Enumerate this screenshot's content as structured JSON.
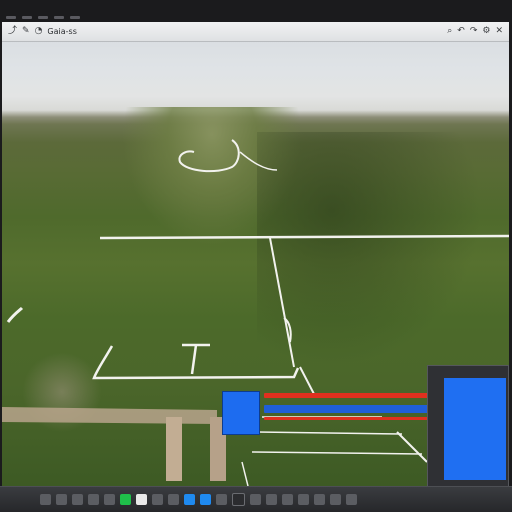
{
  "toolbar": {
    "left_icons": [
      "pointer-icon",
      "pen-icon",
      "shape-icon"
    ],
    "title": "Gaia-ss",
    "right_icons": [
      "search-icon",
      "undo-icon",
      "redo-icon",
      "settings-icon",
      "close-icon"
    ]
  },
  "glyphs": {
    "pointer": "⤴",
    "pen": "✎",
    "shape": "◔",
    "search": "⌕",
    "undo": "↶",
    "redo": "↷",
    "settings": "⚙",
    "close": "✕"
  },
  "colors": {
    "accent_blue": "#1f6ff2",
    "track_red": "#e0301e",
    "track_blue": "#1f5fd8",
    "overlay_white": "#f2f2ee",
    "taskbar_green": "#1fbf4a"
  },
  "taskbar": {
    "icons": [
      "search-field",
      "window-icon",
      "gear-icon",
      "file-icon",
      "folder-icon",
      "app-icon",
      "green-app-icon",
      "document-icon",
      "camera-icon",
      "settings-icon",
      "image-icon",
      "blue-app-icon",
      "media-icon",
      "terminal-icon",
      "circle-icon",
      "bracket-icon",
      "grid-icon",
      "card-icon",
      "menu-icon",
      "stack-icon"
    ]
  }
}
